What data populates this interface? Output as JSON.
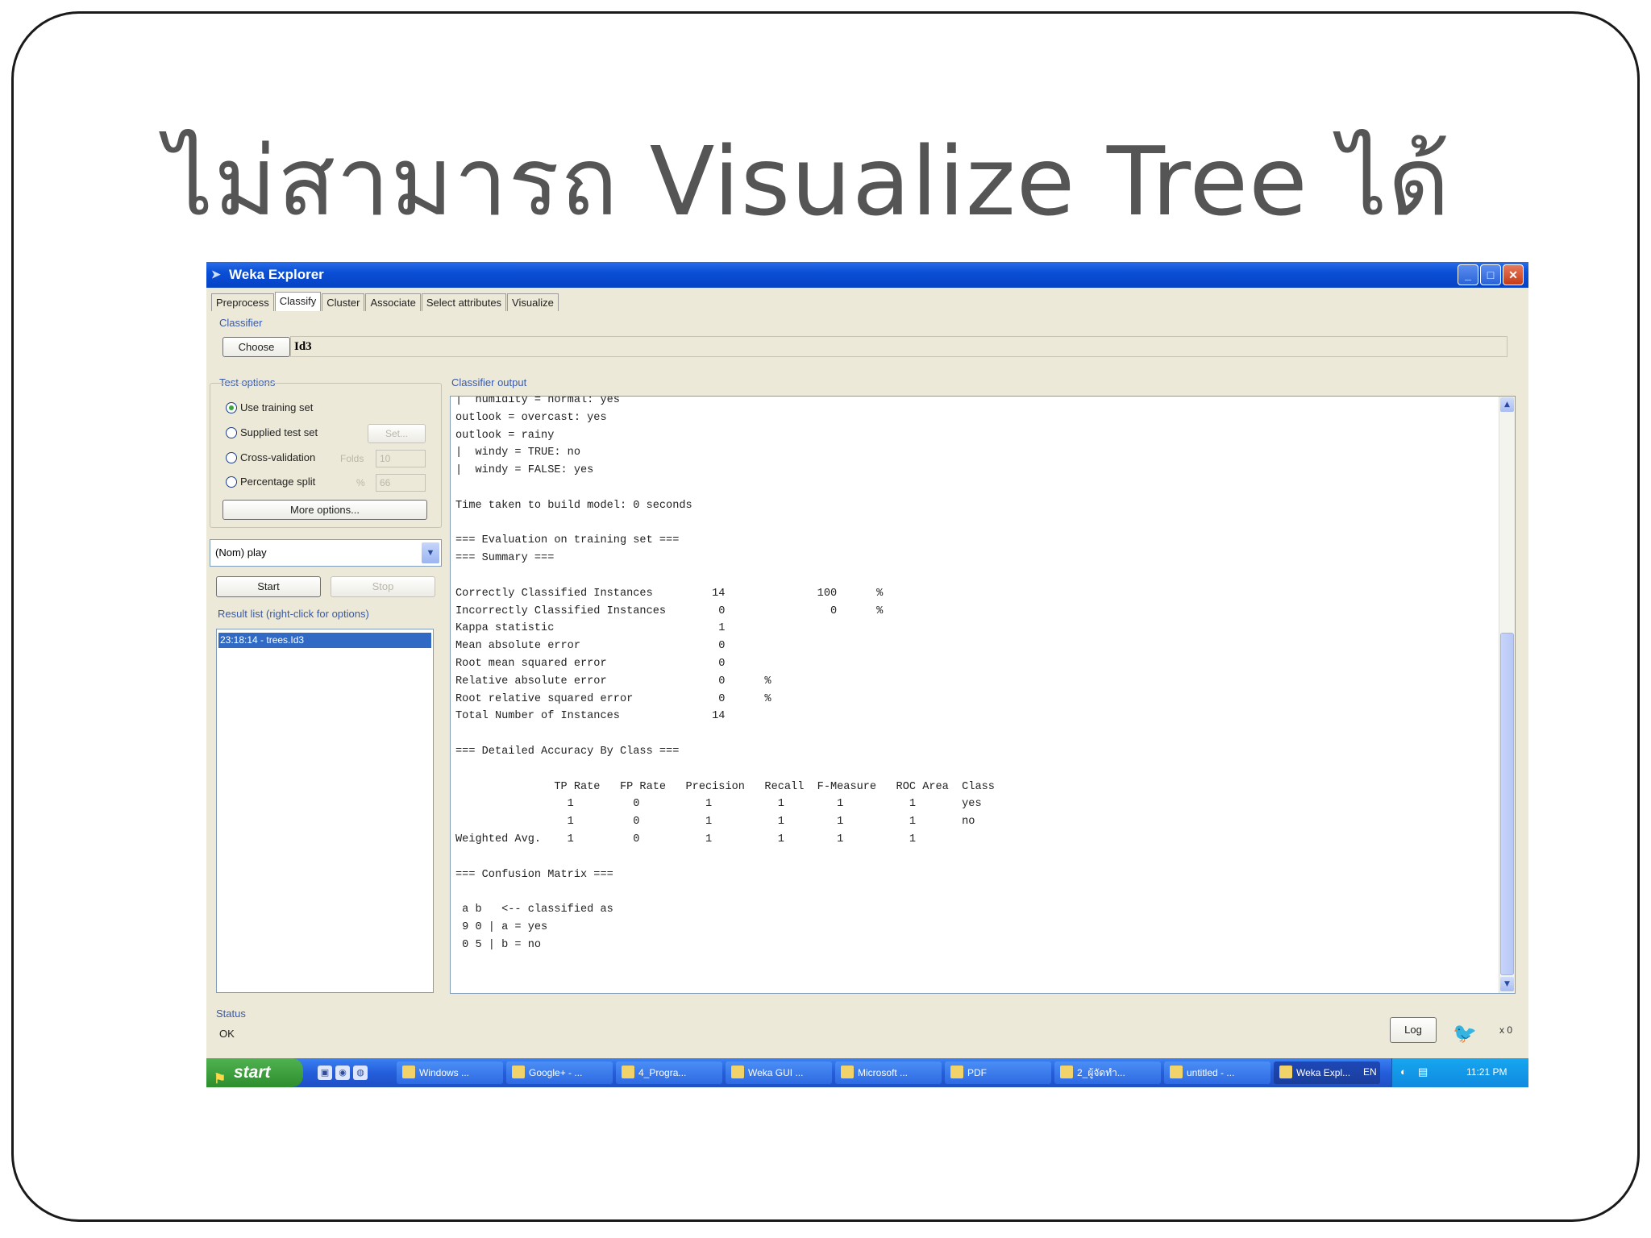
{
  "slide": {
    "title": "ไม่สามารถ Visualize Tree ได้"
  },
  "window": {
    "title": "Weka Explorer",
    "controls": [
      "minimize",
      "maximize",
      "close"
    ],
    "tabs": [
      "Preprocess",
      "Classify",
      "Cluster",
      "Associate",
      "Select attributes",
      "Visualize"
    ],
    "active_tab": "Classify"
  },
  "classifier": {
    "section_label": "Classifier",
    "choose_label": "Choose",
    "value": "Id3"
  },
  "test_options": {
    "label": "Test options",
    "use_training_set": "Use training set",
    "supplied_test_set": "Supplied test set",
    "set_button": "Set...",
    "cross_validation": "Cross-validation",
    "folds_label": "Folds",
    "folds_value": "10",
    "percentage_split": "Percentage split",
    "percent_label": "%",
    "percent_value": "66",
    "more_options": "More options...",
    "selected": "Use training set"
  },
  "class_attribute": {
    "value": "(Nom) play"
  },
  "run": {
    "start": "Start",
    "stop": "Stop"
  },
  "result_list": {
    "label": "Result list (right-click for options)",
    "items": [
      "23:18:14 - trees.Id3"
    ]
  },
  "output": {
    "label": "Classifier output",
    "lines": [
      "|  humidity = normal: yes",
      "outlook = overcast: yes",
      "outlook = rainy",
      "|  windy = TRUE: no",
      "|  windy = FALSE: yes",
      "",
      "Time taken to build model: 0 seconds",
      "",
      "=== Evaluation on training set ===",
      "=== Summary ===",
      "",
      "Correctly Classified Instances         14              100      %",
      "Incorrectly Classified Instances        0                0      %",
      "Kappa statistic                         1",
      "Mean absolute error                     0",
      "Root mean squared error                 0",
      "Relative absolute error                 0      %",
      "Root relative squared error             0      %",
      "Total Number of Instances              14",
      "",
      "=== Detailed Accuracy By Class ===",
      "",
      "               TP Rate   FP Rate   Precision   Recall  F-Measure   ROC Area  Class",
      "                 1         0          1          1        1          1       yes",
      "                 1         0          1          1        1          1       no",
      "Weighted Avg.    1         0          1          1        1          1",
      "",
      "=== Confusion Matrix ===",
      "",
      " a b   <-- classified as",
      " 9 0 | a = yes",
      " 0 5 | b = no"
    ]
  },
  "status": {
    "label": "Status",
    "text": "OK",
    "log_button": "Log",
    "x_count": "x 0"
  },
  "taskbar": {
    "start": "start",
    "tasks": [
      "Windows ...",
      "Google+ - ...",
      "4_Progra...",
      "Weka GUI ...",
      "Microsoft ...",
      "PDF",
      "2_ผู้จัดทำ...",
      "untitled - ...",
      "Weka Expl..."
    ],
    "active_task": "Weka Expl...",
    "lang": "EN",
    "clock": "11:21 PM"
  }
}
